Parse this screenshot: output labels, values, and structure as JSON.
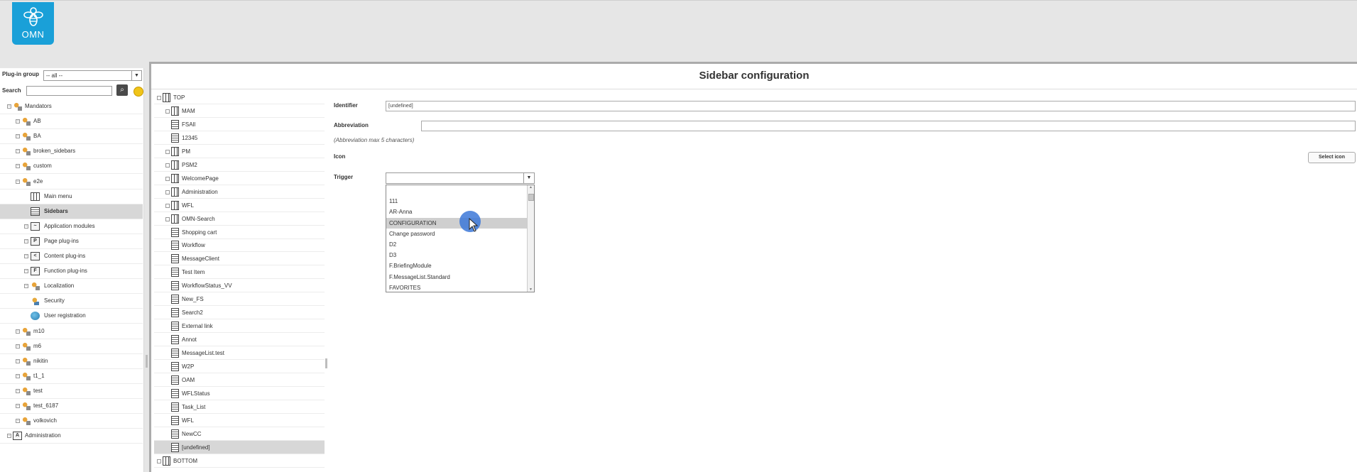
{
  "brand": {
    "logo_text": "OMN"
  },
  "left_panel": {
    "plugin_group_label": "Plug-in group",
    "plugin_group_value": "-- all --",
    "search_label": "Search",
    "search_placeholder": "",
    "tree": [
      {
        "label": "Mandators",
        "level": 0,
        "icon": "mandators-icon",
        "expander": true
      },
      {
        "label": "AB",
        "level": 1,
        "icon": "user-group-icon",
        "expander": true
      },
      {
        "label": "BA",
        "level": 1,
        "icon": "user-group-icon",
        "expander": true
      },
      {
        "label": "broken_sidebars",
        "level": 1,
        "icon": "user-group-icon",
        "expander": true
      },
      {
        "label": "custom",
        "level": 1,
        "icon": "user-group-icon",
        "expander": true
      },
      {
        "label": "e2e",
        "level": 1,
        "icon": "user-group-icon",
        "expander": true
      },
      {
        "label": "Main menu",
        "level": 2,
        "icon": "grid-icon",
        "expander": false
      },
      {
        "label": "Sidebars",
        "level": 2,
        "icon": "list-icon",
        "expander": false,
        "selected": true
      },
      {
        "label": "Application modules",
        "level": 2,
        "icon": "chart-icon",
        "expander": true
      },
      {
        "label": "Page plug-ins",
        "level": 2,
        "icon": "page-icon",
        "expander": true
      },
      {
        "label": "Content plug-ins",
        "level": 2,
        "icon": "content-icon",
        "expander": true
      },
      {
        "label": "Function plug-ins",
        "level": 2,
        "icon": "function-icon",
        "expander": true
      },
      {
        "label": "Localization",
        "level": 2,
        "icon": "user-group-icon",
        "expander": true
      },
      {
        "label": "Security",
        "level": 2,
        "icon": "security-icon",
        "expander": false
      },
      {
        "label": "User registration",
        "level": 2,
        "icon": "globe-icon",
        "expander": false
      },
      {
        "label": "m10",
        "level": 1,
        "icon": "user-group-icon",
        "expander": true
      },
      {
        "label": "m6",
        "level": 1,
        "icon": "user-group-icon",
        "expander": true
      },
      {
        "label": "nikitin",
        "level": 1,
        "icon": "user-group-icon",
        "expander": true
      },
      {
        "label": "t1_1",
        "level": 1,
        "icon": "user-group-icon",
        "expander": true
      },
      {
        "label": "test",
        "level": 1,
        "icon": "user-group-icon",
        "expander": true
      },
      {
        "label": "test_6187",
        "level": 1,
        "icon": "user-group-icon",
        "expander": true
      },
      {
        "label": "volkovich",
        "level": 1,
        "icon": "user-group-icon",
        "expander": true
      },
      {
        "label": "Administration",
        "level": 0,
        "icon": "administration-icon",
        "expander": true
      }
    ]
  },
  "main": {
    "title": "Sidebar configuration",
    "sidebar_tree": [
      {
        "label": "TOP",
        "level": 0,
        "expander": true,
        "icon": "grid"
      },
      {
        "label": "MAM",
        "level": 1,
        "expander": true,
        "icon": "grid"
      },
      {
        "label": "FSAll",
        "level": 1,
        "expander": false,
        "icon": "doc"
      },
      {
        "label": "12345",
        "level": 1,
        "expander": false,
        "icon": "doc"
      },
      {
        "label": "PM",
        "level": 1,
        "expander": true,
        "icon": "grid"
      },
      {
        "label": "PSM2",
        "level": 1,
        "expander": true,
        "icon": "grid"
      },
      {
        "label": "WelcomePage",
        "level": 1,
        "expander": true,
        "icon": "grid"
      },
      {
        "label": "Administration",
        "level": 1,
        "expander": true,
        "icon": "grid"
      },
      {
        "label": "WFL",
        "level": 1,
        "expander": true,
        "icon": "grid"
      },
      {
        "label": "OMN-Search",
        "level": 1,
        "expander": true,
        "icon": "grid"
      },
      {
        "label": "Shopping cart",
        "level": 1,
        "expander": false,
        "icon": "doc"
      },
      {
        "label": "Workflow",
        "level": 1,
        "expander": false,
        "icon": "doc"
      },
      {
        "label": "MessageClient",
        "level": 1,
        "expander": false,
        "icon": "doc"
      },
      {
        "label": "Test Item",
        "level": 1,
        "expander": false,
        "icon": "doc"
      },
      {
        "label": "WorkflowStatus_VV",
        "level": 1,
        "expander": false,
        "icon": "doc"
      },
      {
        "label": "New_FS",
        "level": 1,
        "expander": false,
        "icon": "doc"
      },
      {
        "label": "Search2",
        "level": 1,
        "expander": false,
        "icon": "doc"
      },
      {
        "label": "External link",
        "level": 1,
        "expander": false,
        "icon": "doc"
      },
      {
        "label": "Annot",
        "level": 1,
        "expander": false,
        "icon": "doc"
      },
      {
        "label": "MessageList.test",
        "level": 1,
        "expander": false,
        "icon": "doc"
      },
      {
        "label": "W2P",
        "level": 1,
        "expander": false,
        "icon": "doc"
      },
      {
        "label": "OAM",
        "level": 1,
        "expander": false,
        "icon": "doc"
      },
      {
        "label": "WFLStatus",
        "level": 1,
        "expander": false,
        "icon": "doc"
      },
      {
        "label": "Task_List",
        "level": 1,
        "expander": false,
        "icon": "doc"
      },
      {
        "label": "WFL",
        "level": 1,
        "expander": false,
        "icon": "doc"
      },
      {
        "label": "NewCC",
        "level": 1,
        "expander": false,
        "icon": "doc"
      },
      {
        "label": "[undefined]",
        "level": 1,
        "expander": false,
        "icon": "doc",
        "selected": true
      },
      {
        "label": "BOTTOM",
        "level": 0,
        "expander": true,
        "icon": "grid"
      }
    ],
    "form": {
      "identifier_label": "Identifier",
      "identifier_value": "[undefined]",
      "abbreviation_label": "Abbreviation",
      "abbreviation_value": "",
      "abbreviation_hint": "(Abbreviation max 5 characters)",
      "icon_label": "Icon",
      "select_icon_label": "Select icon",
      "trigger_label": "Trigger",
      "trigger_value": "",
      "trigger_options": [
        "",
        "111",
        "AR-Anna",
        "CONFIGURATION",
        "Change password",
        "D2",
        "D3",
        "F.BriefingModule",
        "F.MessageList.Standard",
        "FAVORITES"
      ],
      "highlighted_option": "CONFIGURATION"
    }
  },
  "colors": {
    "logo_bg": "#1aa0d8",
    "selected_row": "#d7d7d7",
    "cursor_highlight": "#3c78d8"
  }
}
